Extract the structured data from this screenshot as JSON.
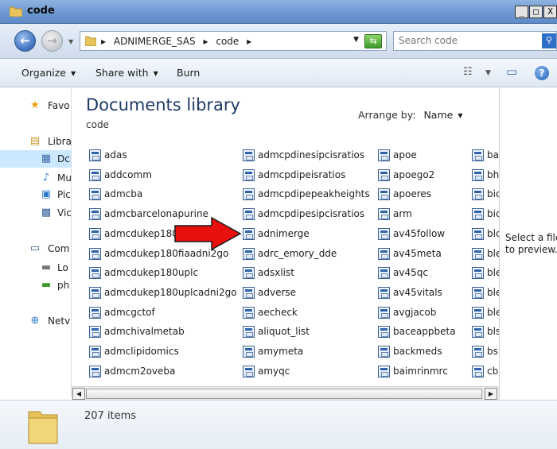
{
  "window": {
    "title": "code",
    "buttons": {
      "minimize": "_",
      "maximize": "□",
      "close": "X"
    }
  },
  "address": {
    "crumbs": [
      "ADNIMERGE_SAS",
      "code"
    ],
    "separator": "▸",
    "search_placeholder": "Search code"
  },
  "toolbar": {
    "organize": "Organize",
    "share_with": "Share with",
    "burn": "Burn"
  },
  "nav": {
    "items": [
      {
        "label": "Favo",
        "icon": "star-icon"
      },
      {
        "label": "Libra",
        "icon": "library-icon"
      },
      {
        "label": "Dc",
        "icon": "documents-icon",
        "selected": true
      },
      {
        "label": "Mu",
        "icon": "music-icon"
      },
      {
        "label": "Pic",
        "icon": "pictures-icon"
      },
      {
        "label": "Vic",
        "icon": "videos-icon"
      },
      {
        "label": "Com",
        "icon": "computer-icon"
      },
      {
        "label": "Lo",
        "icon": "local-disk-icon"
      },
      {
        "label": "ph",
        "icon": "network-drive-icon"
      },
      {
        "label": "Netv",
        "icon": "network-icon"
      }
    ]
  },
  "library": {
    "title": "Documents library",
    "subtitle": "code",
    "arrange_label": "Arrange by:",
    "arrange_value": "Name"
  },
  "files": {
    "columns": [
      [
        "adas",
        "addcomm",
        "admcba",
        "admcbarcelonapurine",
        "admcdukep180f",
        "admcdukep180fiaadni2go",
        "admcdukep180uplc",
        "admcdukep180uplcadni2go",
        "admcgctof",
        "admchivalmetab",
        "admclipidomics",
        "admcm2oveba"
      ],
      [
        "admcpdinesipcisratios",
        "admcpdipeisratios",
        "admcpdipepeakheights",
        "admcpdipesipcisratios",
        "adnimerge",
        "adrc_emory_dde",
        "adsxlist",
        "adverse",
        "aecheck",
        "aliquot_list",
        "amymeta",
        "amyqc"
      ],
      [
        "apoe",
        "apoego2",
        "apoeres",
        "arm",
        "av45follow",
        "av45meta",
        "av45qc",
        "av45vitals",
        "avgjacob",
        "baceappbeta",
        "backmeds",
        "baimrinmrc"
      ],
      [
        "ba",
        "bh",
        "bic",
        "bic",
        "blc",
        "ble",
        "ble",
        "ble",
        "ble",
        "bls",
        "bs",
        "cb"
      ]
    ]
  },
  "preview": {
    "line1": "Select a file",
    "line2": "to preview."
  },
  "details": {
    "count": "207 items"
  },
  "colors": {
    "accent_red": "#e8100c",
    "selected_bg": "#cce8ff"
  }
}
